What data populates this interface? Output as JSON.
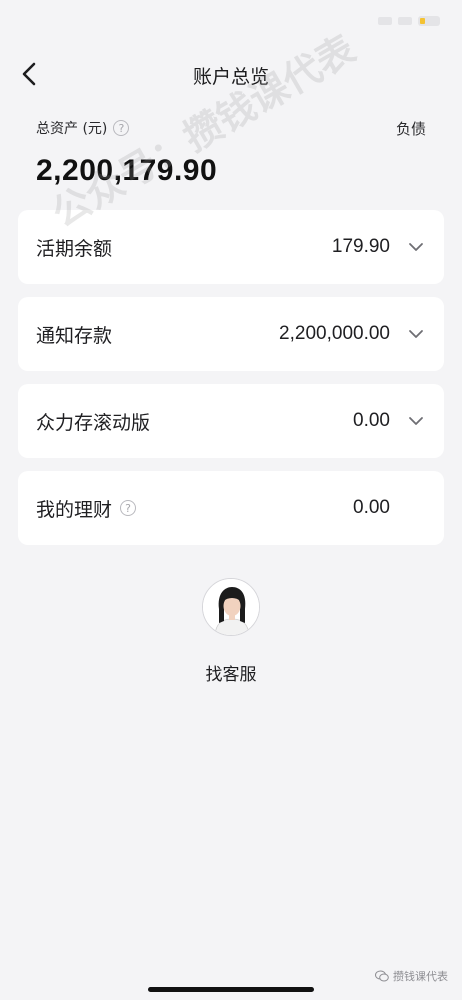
{
  "nav": {
    "title": "账户总览"
  },
  "summary": {
    "total_label": "总资产 (元)",
    "help": "?",
    "liabilities_label": "负债",
    "total_value": "2,200,179.90"
  },
  "accounts": [
    {
      "name": "活期余额",
      "value": "179.90",
      "expandable": true
    },
    {
      "name": "通知存款",
      "value": "2,200,000.00",
      "expandable": true
    },
    {
      "name": "众力存滚动版",
      "value": "0.00",
      "expandable": true
    },
    {
      "name": "我的理财",
      "value": "0.00",
      "expandable": false,
      "help": "?"
    }
  ],
  "service": {
    "label": "找客服"
  },
  "watermark": {
    "text": "公众号：攒钱课代表"
  },
  "footer": {
    "text": "攒钱课代表"
  },
  "colors": {
    "background": "#f4f4f6",
    "card": "#ffffff",
    "text": "#1f1f22"
  }
}
